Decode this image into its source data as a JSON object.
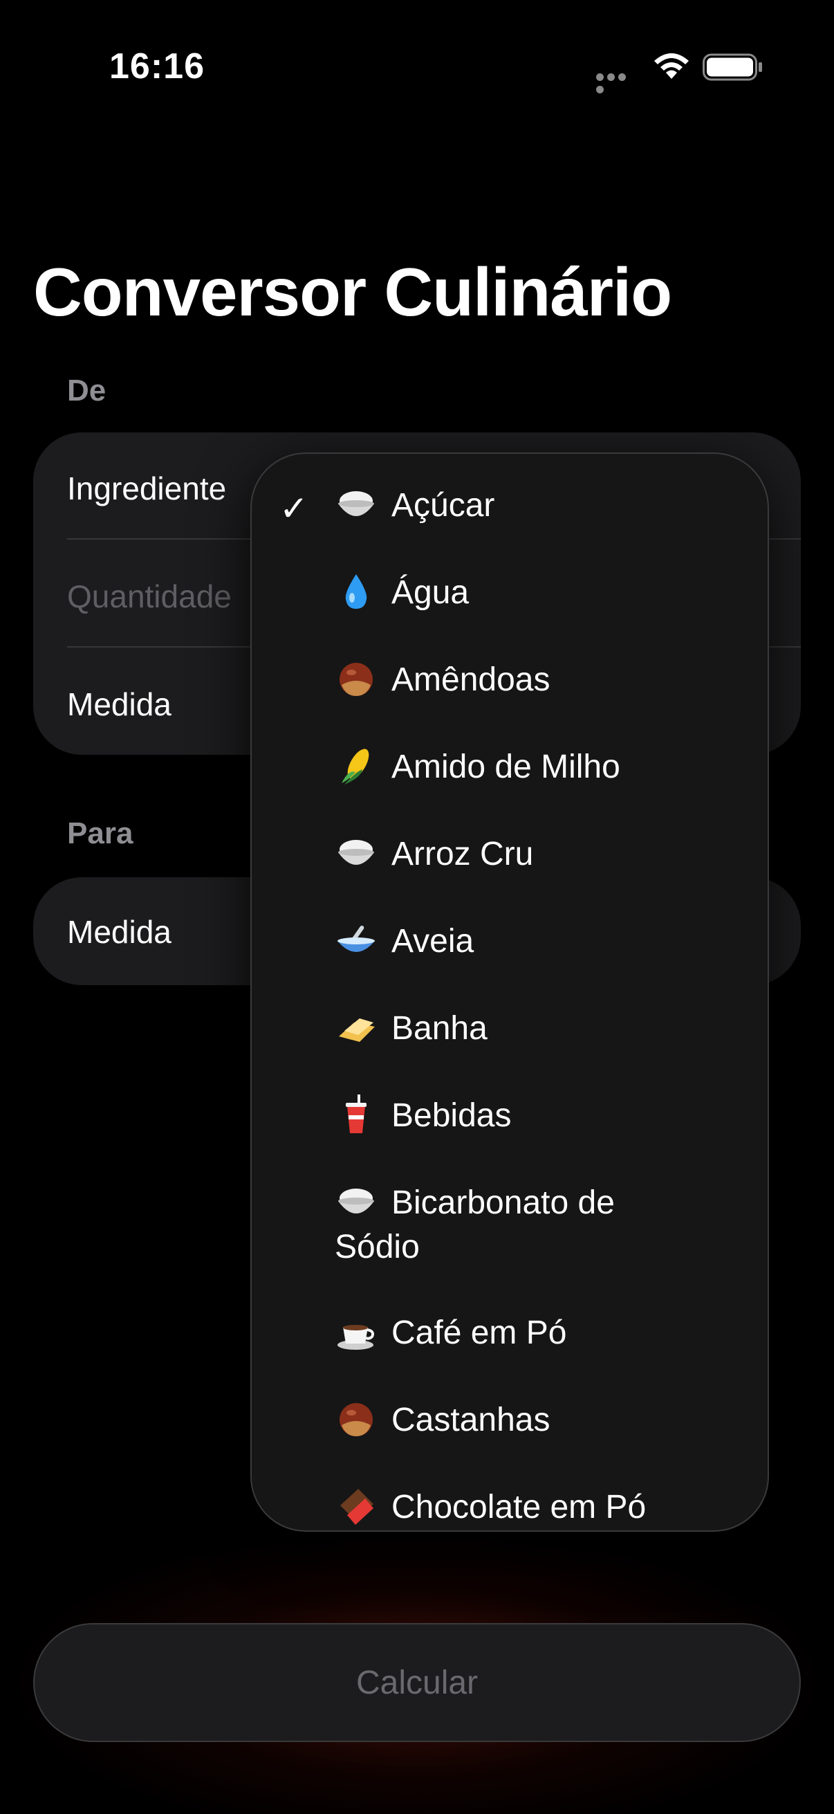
{
  "status_bar": {
    "time": "16:16"
  },
  "title": "Conversor Culinário",
  "from_section": {
    "label": "De",
    "ingredient_label": "Ingrediente",
    "quantity_placeholder": "Quantidade",
    "measure_label": "Medida"
  },
  "to_section": {
    "label": "Para",
    "measure_label": "Medida"
  },
  "menu": {
    "selected_index": 0,
    "items": [
      {
        "icon": "rice-bowl-icon",
        "label": "Açúcar"
      },
      {
        "icon": "droplet-icon",
        "label": "Água"
      },
      {
        "icon": "chestnut-icon",
        "label": "Amêndoas"
      },
      {
        "icon": "corn-icon",
        "label": "Amido de Milho"
      },
      {
        "icon": "rice-bowl-icon",
        "label": "Arroz Cru"
      },
      {
        "icon": "bowl-spoon-icon",
        "label": "Aveia"
      },
      {
        "icon": "butter-icon",
        "label": "Banha"
      },
      {
        "icon": "cup-straw-icon",
        "label": "Bebidas"
      },
      {
        "icon": "rice-bowl-icon",
        "label": "Bicarbonato de Sódio"
      },
      {
        "icon": "coffee-icon",
        "label": "Café em Pó"
      },
      {
        "icon": "chestnut-icon",
        "label": "Castanhas"
      },
      {
        "icon": "chocolate-icon",
        "label": "Chocolate em Pó"
      }
    ]
  },
  "calculate_button": "Calcular",
  "colors": {
    "background": "#000000",
    "card": "#1c1c1e",
    "secondary_text": "#8e8e93"
  }
}
